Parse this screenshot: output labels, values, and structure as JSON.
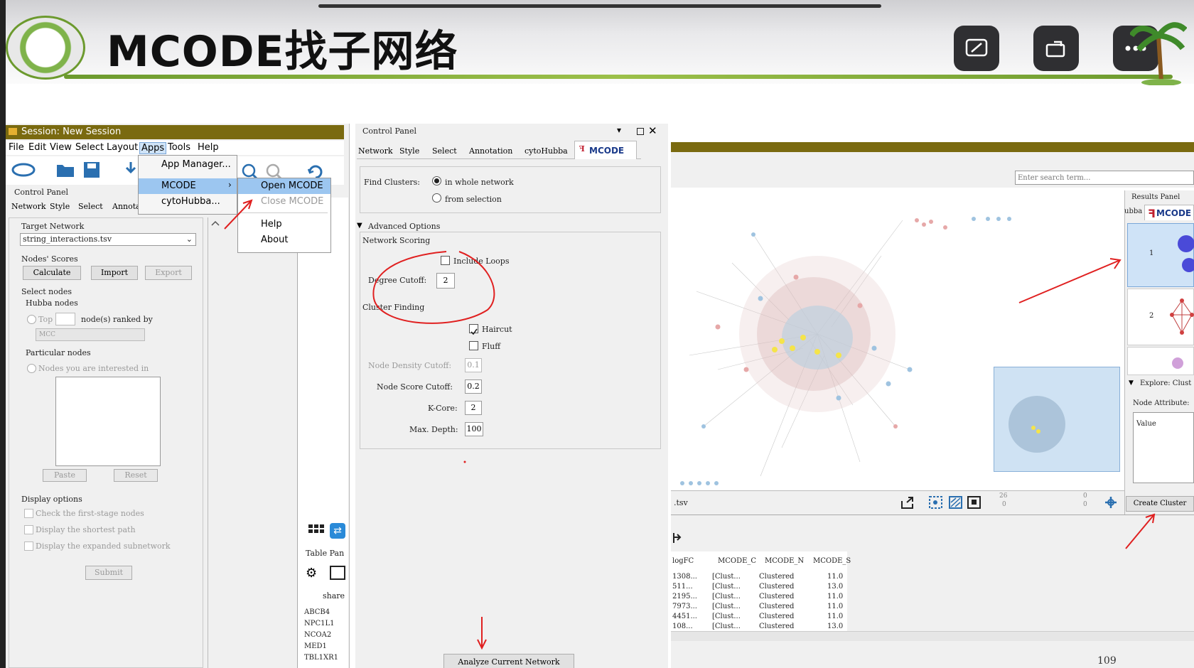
{
  "slide": {
    "title": "MCODE找子网络",
    "corner_buttons": [
      "caption-icon",
      "rotate-screen-icon",
      "more-icon"
    ]
  },
  "session": {
    "title": "Session: New Session",
    "menu": [
      "File",
      "Edit",
      "View",
      "Select",
      "Layout",
      "Apps",
      "Tools",
      "Help"
    ],
    "control_panel_label": "Control Panel",
    "tabs": [
      "Network",
      "Style",
      "Select",
      "Annota"
    ],
    "target_network_label": "Target Network",
    "target_network_value": "string_interactions.tsv",
    "nodes_scores_label": "Nodes' Scores",
    "buttons": {
      "calculate": "Calculate",
      "import": "Import",
      "export": "Export"
    },
    "select_nodes_label": "Select nodes",
    "hubba_nodes_label": "Hubba nodes",
    "top_label": "Top",
    "ranked_by_label": "node(s) ranked by",
    "method_value": "MCC",
    "particular_nodes_label": "Particular nodes",
    "interested_label": "Nodes you are interested in",
    "paste_label": "Paste",
    "reset_label": "Reset",
    "display_options_label": "Display options",
    "options": [
      "Check the first-stage nodes",
      "Display the shortest path",
      "Display the expanded subnetwork"
    ],
    "submit_label": "Submit"
  },
  "apps_menu": {
    "items": [
      "App Manager...",
      "MCODE",
      "cytoHubba..."
    ],
    "submenu": [
      "Open MCODE",
      "Close MCODE",
      "Help",
      "About"
    ]
  },
  "control_panel": {
    "title": "Control Panel",
    "tabs": [
      "Network",
      "Style",
      "Select",
      "Annotation",
      "cytoHubba",
      "MCODE"
    ],
    "find_clusters_label": "Find Clusters:",
    "scope_options": [
      "in whole network",
      "from selection"
    ],
    "advanced_label": "Advanced Options",
    "network_scoring_label": "Network Scoring",
    "include_loops_label": "Include Loops",
    "degree_cutoff_label": "Degree Cutoff:",
    "degree_cutoff_value": "2",
    "cluster_finding_label": "Cluster Finding",
    "haircut_label": "Haircut",
    "fluff_label": "Fluff",
    "node_density_label": "Node Density Cutoff:",
    "node_density_value": "0.1",
    "node_score_label": "Node Score Cutoff:",
    "node_score_value": "0.2",
    "kcore_label": "K-Core:",
    "kcore_value": "2",
    "max_depth_label": "Max. Depth:",
    "max_depth_value": "100",
    "analyze_label": "Analyze Current Network"
  },
  "side_strip": {
    "table_panel_label": "Table Pan",
    "shared_label": "share",
    "genes": [
      "ABCB4",
      "NPC1L1",
      "NCOA2",
      "MED1",
      "TBL1XR1"
    ]
  },
  "network_view": {
    "search_placeholder": "Enter search term...",
    "file_label": ".tsv",
    "counts": [
      "26",
      "0",
      "0",
      "0"
    ]
  },
  "results_panel": {
    "title": "Results Panel",
    "tabs": [
      "ubba",
      "MCODE"
    ],
    "cluster_ranks": [
      "1",
      "2"
    ],
    "explore_label": "Explore: Clust",
    "node_attribute_label": "Node Attribute:",
    "value_label": "Value",
    "create_cluster_label": "Create Cluster"
  },
  "node_table": {
    "headers": [
      "logFC",
      "MCODE_C",
      "MCODE_N",
      "MCODE_S"
    ],
    "rows": [
      [
        "1308...",
        "[Clust...",
        "Clustered",
        "11.0"
      ],
      [
        "511...",
        "[Clust...",
        "Clustered",
        "13.0"
      ],
      [
        "2195...",
        "[Clust...",
        "Clustered",
        "11.0"
      ],
      [
        "7973...",
        "[Clust...",
        "Clustered",
        "11.0"
      ],
      [
        "4451...",
        "[Clust...",
        "Clustered",
        "11.0"
      ],
      [
        "108...",
        "[Clust...",
        "Clustered",
        "13.0"
      ]
    ]
  },
  "page_number": "109",
  "colors": {
    "title_bar": "#7a6a10",
    "menu_highlight": "#9cc6f0",
    "annotation": "#e02020",
    "accent_green": "#7fb34a"
  }
}
